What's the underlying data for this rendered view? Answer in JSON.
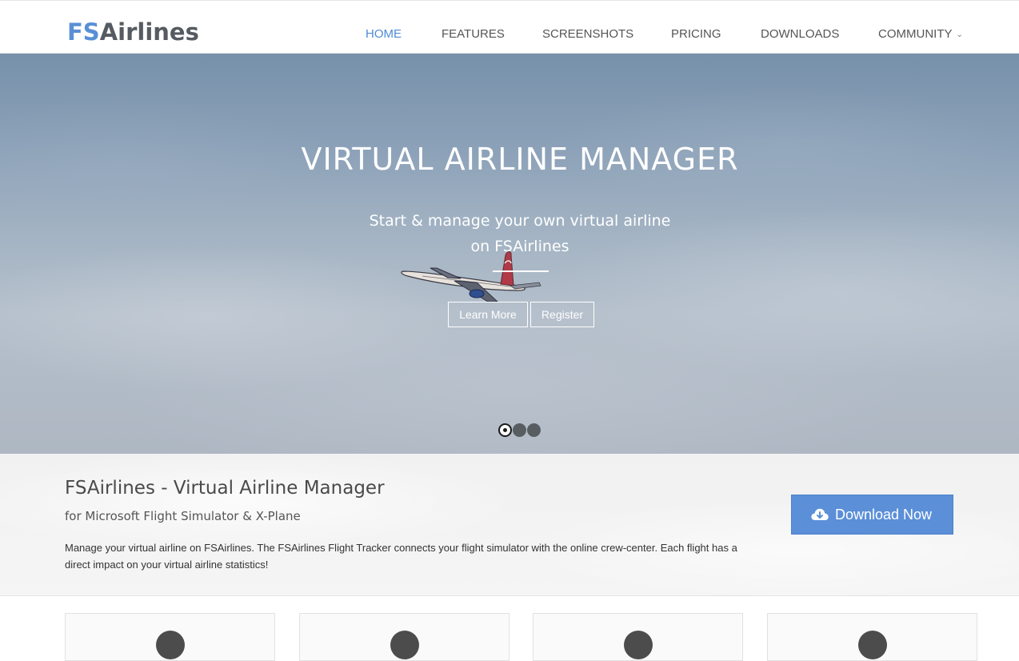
{
  "brand": {
    "logo_part1": "FS",
    "logo_part2": "Airlines",
    "accent_color": "#5a8fd6"
  },
  "nav": {
    "items": [
      {
        "label": "HOME",
        "active": true
      },
      {
        "label": "FEATURES",
        "active": false
      },
      {
        "label": "SCREENSHOTS",
        "active": false
      },
      {
        "label": "PRICING",
        "active": false
      },
      {
        "label": "DOWNLOADS",
        "active": false
      },
      {
        "label": "COMMUNITY",
        "active": false,
        "icon": "chevron-down-icon"
      }
    ]
  },
  "hero": {
    "title": "VIRTUAL AIRLINE MANAGER",
    "subtitle_line1": "Start & manage your own virtual airline",
    "subtitle_line2": "on FSAirlines",
    "learn_more_label": "Learn More",
    "register_label": "Register",
    "slides_total": 3,
    "active_slide": 1
  },
  "intro": {
    "title": "FSAirlines - Virtual Airline Manager",
    "subtitle": "for Microsoft Flight Simulator & X-Plane",
    "text": "Manage your virtual airline on FSAirlines. The FSAirlines Flight Tracker connects your flight simulator with the online crew-center. Each flight has a direct impact on your virtual airline statistics!",
    "download_label": "Download Now",
    "download_icon": "cloud-download-icon",
    "download_color": "#5b8fd8"
  },
  "features": {
    "card_count": 4
  }
}
